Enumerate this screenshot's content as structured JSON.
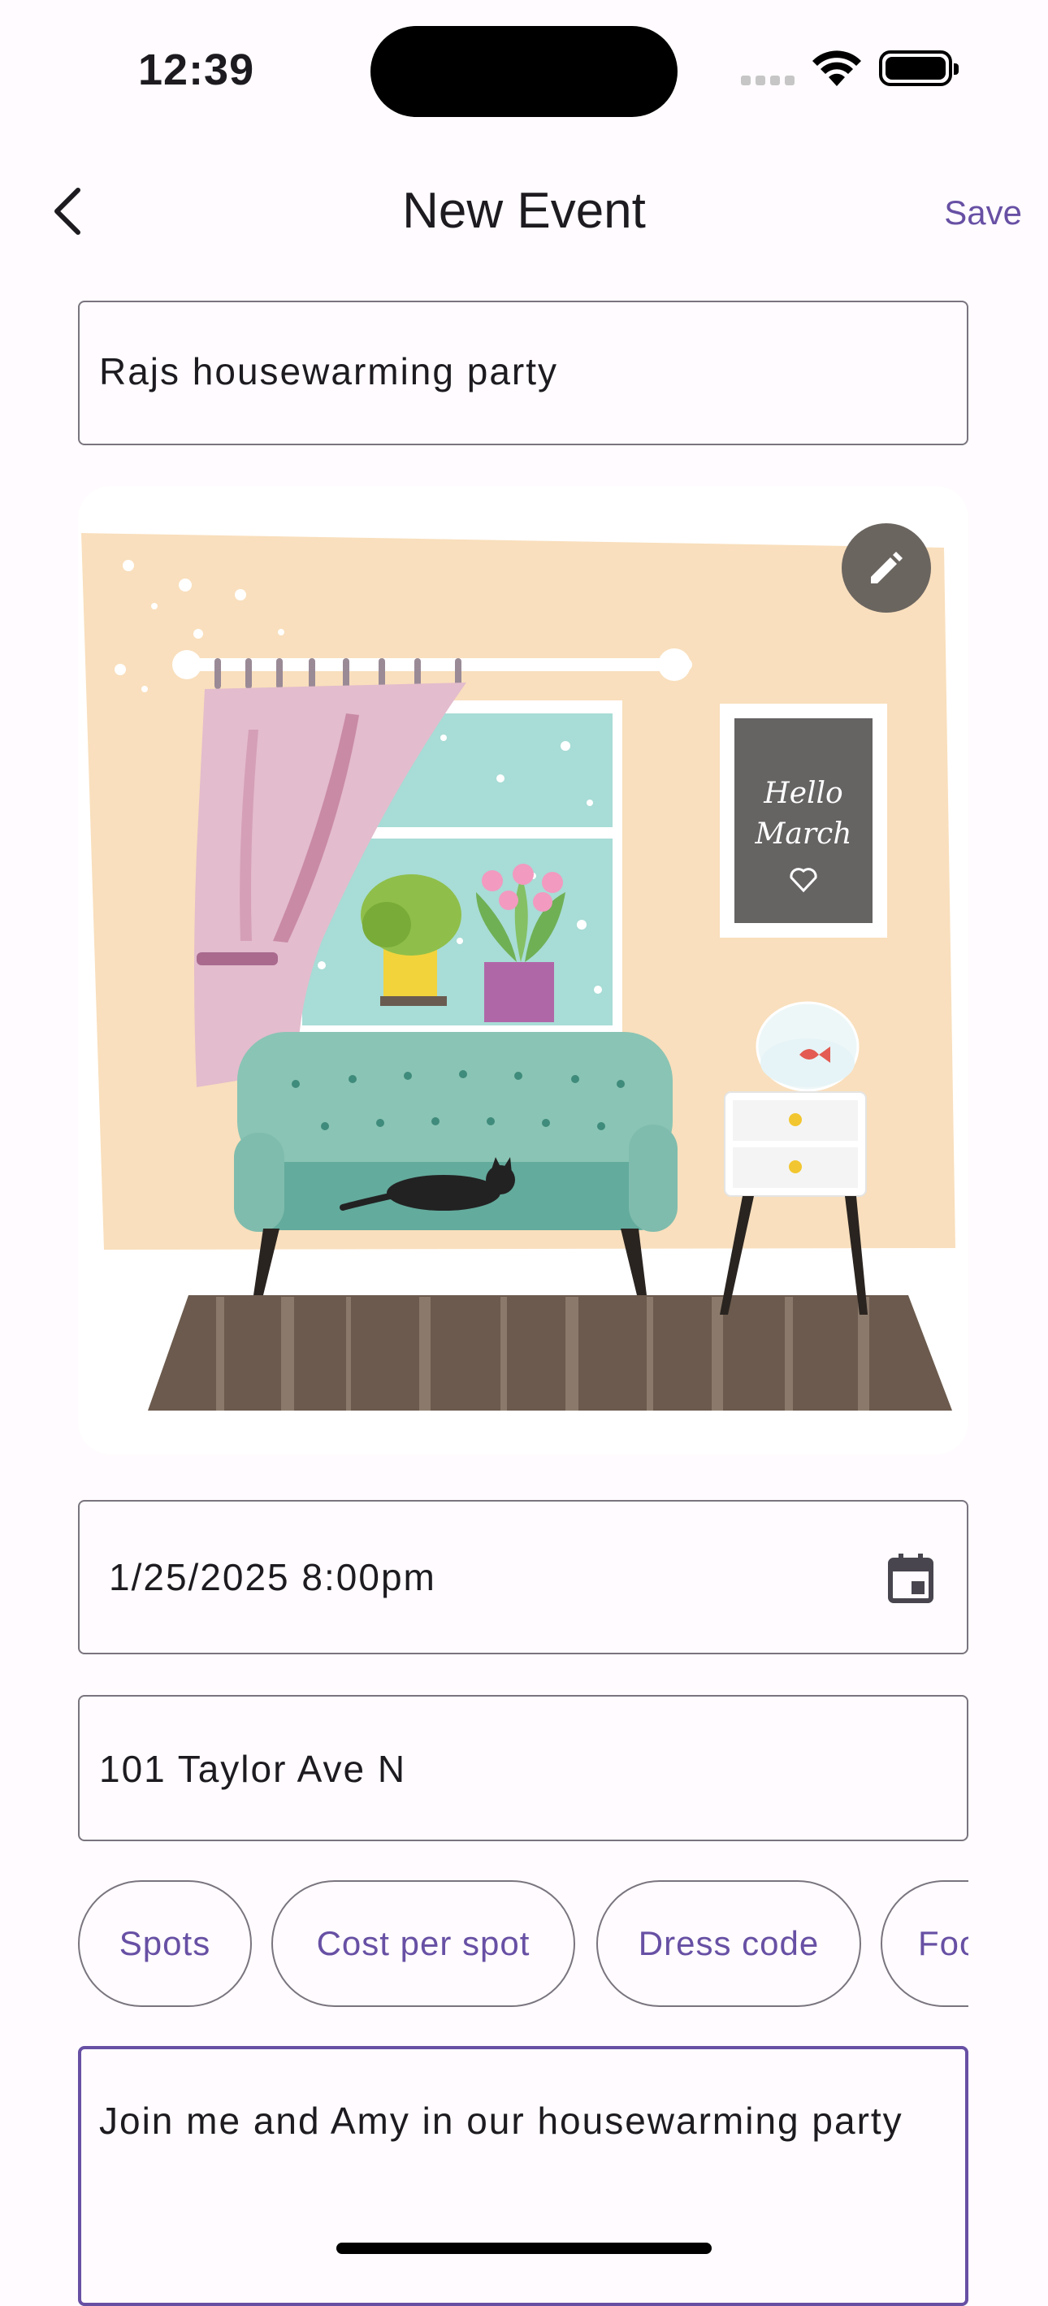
{
  "status_bar": {
    "time": "12:39"
  },
  "nav": {
    "title": "New Event",
    "save_label": "Save"
  },
  "event": {
    "title": "Rajs housewarming party",
    "datetime": "1/25/2025 8:00pm",
    "location": "101 Taylor Ave N",
    "description": "Join me and Amy in our housewarming party"
  },
  "illustration": {
    "poster_line1": "Hello",
    "poster_line2": "March"
  },
  "chips": [
    "Spots",
    "Cost per spot",
    "Dress code",
    "Food"
  ],
  "colors": {
    "accent": "#6750a4",
    "outline": "#79747e",
    "background": "#fffbfe"
  },
  "icons": [
    "back-arrow-icon",
    "pencil-icon",
    "calendar-icon",
    "wifi-icon",
    "battery-icon"
  ]
}
